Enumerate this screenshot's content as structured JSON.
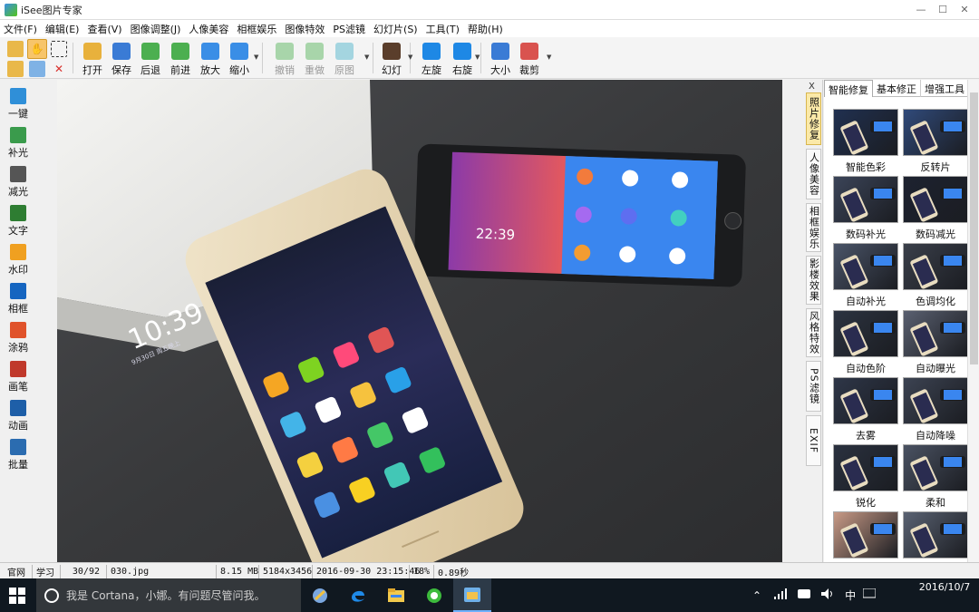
{
  "window": {
    "title": "iSee图片专家"
  },
  "menu": [
    "文件(F)",
    "编辑(E)",
    "查看(V)",
    "图像调整(J)",
    "人像美容",
    "相框娱乐",
    "图像特效",
    "PS滤镜",
    "幻灯片(S)",
    "工具(T)",
    "帮助(H)"
  ],
  "toolbar": {
    "buttons": [
      {
        "label": "打开",
        "icon": "folder-open-icon",
        "color": "#e8b13c"
      },
      {
        "label": "保存",
        "icon": "save-icon",
        "color": "#3a7bd5"
      },
      {
        "label": "后退",
        "icon": "back-image-icon",
        "color": "#4caf50"
      },
      {
        "label": "前进",
        "icon": "forward-image-icon",
        "color": "#4caf50"
      },
      {
        "label": "放大",
        "icon": "zoom-in-icon",
        "color": "#3a8ee6"
      },
      {
        "label": "缩小",
        "icon": "zoom-out-icon",
        "color": "#3a8ee6"
      },
      {
        "label": "撤销",
        "icon": "undo-icon",
        "color": "#4caf50",
        "disabled": true
      },
      {
        "label": "重做",
        "icon": "redo-icon",
        "color": "#4caf50",
        "disabled": true
      },
      {
        "label": "原图",
        "icon": "original-icon",
        "color": "#43b0c7",
        "disabled": true
      },
      {
        "label": "幻灯",
        "icon": "slideshow-icon",
        "color": "#5a3e2b"
      },
      {
        "label": "左旋",
        "icon": "rotate-left-icon",
        "color": "#1e88e5"
      },
      {
        "label": "右旋",
        "icon": "rotate-right-icon",
        "color": "#1e88e5"
      },
      {
        "label": "大小",
        "icon": "resize-icon",
        "color": "#3a7bd5"
      },
      {
        "label": "裁剪",
        "icon": "crop-icon",
        "color": "#d9534f"
      }
    ]
  },
  "left_tools": [
    {
      "label": "一键",
      "icon": "one-click-icon",
      "color": "#2f8fd8"
    },
    {
      "label": "补光",
      "icon": "fill-light-icon",
      "color": "#3a9b4c"
    },
    {
      "label": "减光",
      "icon": "reduce-light-icon",
      "color": "#555555"
    },
    {
      "label": "文字",
      "icon": "text-icon",
      "color": "#2e7d32"
    },
    {
      "label": "水印",
      "icon": "watermark-icon",
      "color": "#f0a020"
    },
    {
      "label": "相框",
      "icon": "frame-icon",
      "color": "#1565c0"
    },
    {
      "label": "涂鸦",
      "icon": "paint-icon",
      "color": "#e0522a"
    },
    {
      "label": "画笔",
      "icon": "brush-icon",
      "color": "#c0392b"
    },
    {
      "label": "动画",
      "icon": "animation-icon",
      "color": "#1e5fa8"
    },
    {
      "label": "批量",
      "icon": "batch-icon",
      "color": "#2b6cb0"
    }
  ],
  "side_tabs": {
    "close": "X",
    "vertical": [
      "照片修复",
      "人像美容",
      "相框娱乐",
      "影楼效果",
      "风格特效",
      "PS滤镜",
      "EXIF"
    ],
    "active_vertical": 0
  },
  "right_panel": {
    "tabs": [
      "智能修复",
      "基本修正",
      "增强工具"
    ],
    "active_tab": 0,
    "effects": [
      {
        "label": "智能色彩",
        "tint": "#203050"
      },
      {
        "label": "反转片",
        "tint": "#304a7a"
      },
      {
        "label": "数码补光",
        "tint": "#3b4458"
      },
      {
        "label": "数码减光",
        "tint": "#1d2230"
      },
      {
        "label": "自动补光",
        "tint": "#4a5468"
      },
      {
        "label": "色调均化",
        "tint": "#3a3f4a"
      },
      {
        "label": "自动色阶",
        "tint": "#2c3340"
      },
      {
        "label": "自动曝光",
        "tint": "#5a6070"
      },
      {
        "label": "去雾",
        "tint": "#2e3648"
      },
      {
        "label": "自动降噪",
        "tint": "#3c4352"
      },
      {
        "label": "锐化",
        "tint": "#2a313f"
      },
      {
        "label": "柔和",
        "tint": "#4a5262"
      },
      {
        "label": "",
        "tint": "#c89a86"
      },
      {
        "label": "",
        "tint": "#5a6272"
      }
    ]
  },
  "status": {
    "btn_site": "官网",
    "btn_learn": "学习",
    "index": "30/92",
    "filename": "030.jpg",
    "filesize": "8.15 MB",
    "dimensions": "5184x3456",
    "datetime": "2016-09-30 23:15:46",
    "zoom": "18%",
    "loadtime": "0.89秒"
  },
  "photo": {
    "phone_left_time": "10:39",
    "phone_left_date": "9月30日 周五晚上",
    "phone_right_time": "22:39"
  },
  "taskbar": {
    "search_text": "我是 Cortana，小娜。有问题尽管问我。",
    "tray_lang": "中",
    "date": "2016/10/7",
    "time": ""
  }
}
